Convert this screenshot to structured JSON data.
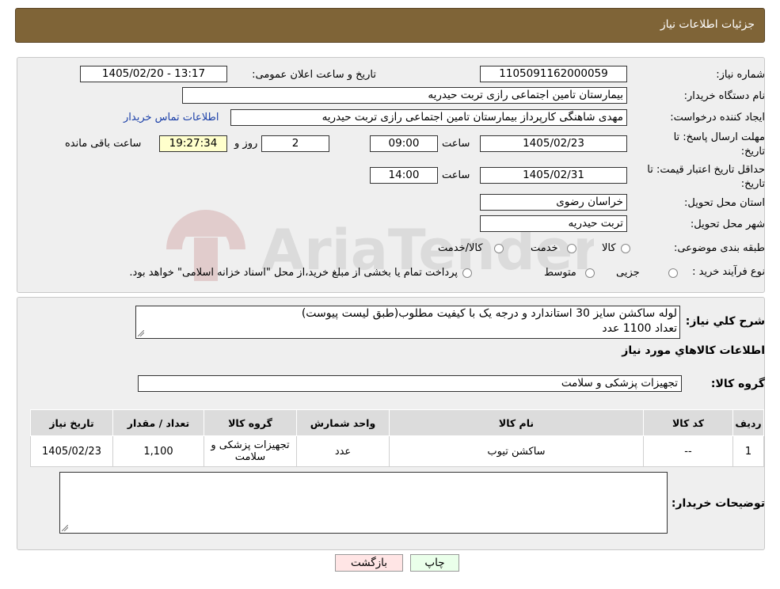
{
  "header": {
    "title": "جزئیات اطلاعات نیاز"
  },
  "form": {
    "need_number_label": "شماره نیاز:",
    "need_number": "1105091162000059",
    "announce_label": "تاریخ و ساعت اعلان عمومی:",
    "announce_value": "1405/02/20 - 13:17",
    "buyer_org_label": "نام دستگاه خریدار:",
    "buyer_org": "بیمارستان تامین اجتماعی رازی تربت حیدریه",
    "creator_label": "ایجاد کننده درخواست:",
    "creator": "مهدی شاهنگی کارپرداز بیمارستان تامین اجتماعی رازی تربت حیدریه",
    "contact_link": "اطلاعات تماس خریدار",
    "reply_deadline_label_1": "مهلت ارسال پاسخ: تا",
    "reply_deadline_label_2": "تاریخ:",
    "reply_date": "1405/02/23",
    "time_label": "ساعت",
    "reply_time": "09:00",
    "days": "2",
    "days_label": "روز و",
    "remaining": "19:27:34",
    "remaining_label": "ساعت باقی مانده",
    "price_validity_label_1": "حداقل تاریخ اعتبار قیمت: تا",
    "price_validity_label_2": "تاریخ:",
    "validity_date": "1405/02/31",
    "validity_time": "14:00",
    "province_label": "استان محل تحویل:",
    "province": "خراسان رضوی",
    "city_label": "شهر محل تحویل:",
    "city": "تربت حیدریه",
    "category_label": "طبقه بندی موضوعی:",
    "category_options": [
      "کالا",
      "خدمت",
      "کالا/خدمت"
    ],
    "process_label": "نوع فرآیند خرید :",
    "process_options": [
      "جزیی",
      "متوسط"
    ],
    "process_note": "پرداخت تمام یا بخشی از مبلغ خرید،از محل \"اسناد خزانه اسلامی\" خواهد بود."
  },
  "details": {
    "general_desc_label": "شرح کلي نياز:",
    "general_desc_line1": "لوله ساکشن سایز 30 استاندارد و درجه یک با کیفیت مطلوب(طبق لیست پیوست)",
    "general_desc_line2": "تعداد 1100 عدد",
    "goods_info_title": "اطلاعات کالاهاي مورد نياز",
    "goods_group_label": "گروه کالا:",
    "goods_group": "تجهیزات پزشکی و سلامت",
    "table": {
      "headers": [
        "رديف",
        "کد کالا",
        "نام کالا",
        "واحد شمارش",
        "گروه کالا",
        "تعداد / مقدار",
        "تاریخ نیاز"
      ],
      "rows": [
        [
          "1",
          "--",
          "ساکشن تیوب",
          "عدد",
          "تجهیزات پزشکی و سلامت",
          "1,100",
          "1405/02/23"
        ]
      ]
    },
    "buyer_notes_label": "توضیحات خریدار:",
    "buyer_notes": ""
  },
  "buttons": {
    "print": "چاپ",
    "back": "بازگشت"
  },
  "watermark": {
    "text": "AriaTender.neT"
  },
  "colors": {
    "header": "#7f6437",
    "panel": "#efefef",
    "link": "#1a3fa8",
    "remaining": "#ffffcc",
    "back_btn": "#ffe5e5",
    "print_btn": "#eaffea"
  }
}
